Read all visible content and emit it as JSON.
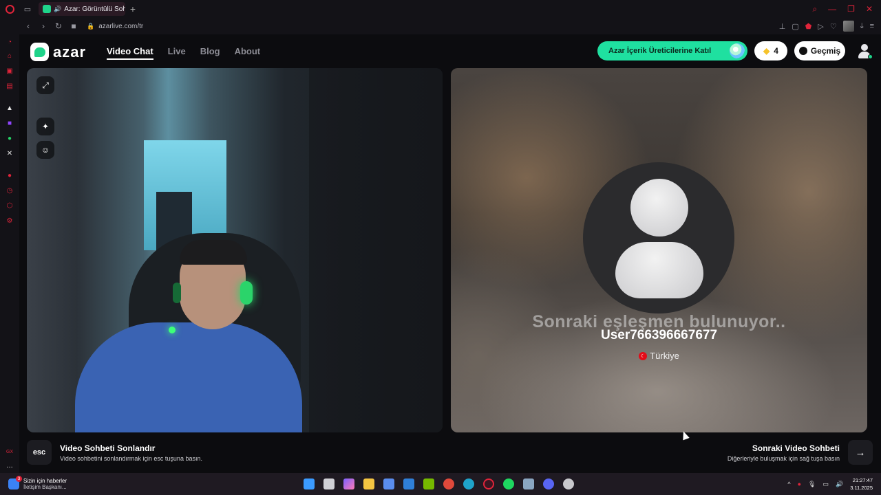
{
  "browser": {
    "tab_title": "Azar: Görüntülü Sohbet",
    "url": "azarlive.com/tr"
  },
  "header": {
    "logo_text": "azar",
    "nav": [
      {
        "label": "Video Chat",
        "active": true
      },
      {
        "label": "Live"
      },
      {
        "label": "Blog"
      },
      {
        "label": "About"
      }
    ],
    "creator_button": "Azar İçerik Üreticilerine Katıl",
    "gems_count": "4",
    "history_button": "Geçmiş"
  },
  "remote": {
    "status_text": "Sonraki eşleşmen bulunuyor..",
    "username": "User766396667677",
    "country": "Türkiye"
  },
  "footer": {
    "esc_key": "esc",
    "end_title": "Video Sohbeti Sonlandır",
    "end_sub": "Video sohbetini sonlandırmak için esc tuşuna basın.",
    "next_title": "Sonraki Video Sohbeti",
    "next_sub": "Diğerleriyle buluşmak için sağ tuşa basın",
    "next_arrow": "→"
  },
  "taskbar": {
    "news_title": "Sizin için haberler",
    "news_sub": "İletişim Başkanı...",
    "news_badge": "3",
    "time": "21:27:47",
    "date": "3.11.2025"
  },
  "colors": {
    "accent": "#1fe0a0",
    "brand_green": "#1fd38a",
    "opera_red": "#e0243a"
  },
  "icons": [
    "opera-logo-icon",
    "workspace-icon",
    "speaker-icon",
    "new-tab-icon",
    "back-icon",
    "forward-icon",
    "reload-icon",
    "camera-icon",
    "lock-icon",
    "expand-icon",
    "sparkle-icon",
    "face-icon",
    "gem-icon",
    "clock-icon",
    "profile-icon",
    "arrow-right-icon"
  ]
}
